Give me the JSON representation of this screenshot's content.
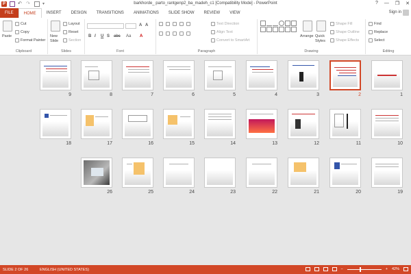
{
  "window": {
    "title": "barkhorde_ parto_rantgenp2_ba_madeh_c1 [Compatibility Mode] - PowerPoint",
    "app_icon": "P",
    "controls": [
      "?",
      "—",
      "❐",
      "✕"
    ]
  },
  "tabs": {
    "file": "FILE",
    "items": [
      "HOME",
      "INSERT",
      "DESIGN",
      "TRANSITIONS",
      "ANIMATIONS",
      "SLIDE SHOW",
      "REVIEW",
      "VIEW"
    ],
    "active": "HOME",
    "sign_in": "Sign in"
  },
  "ribbon": {
    "clipboard": {
      "label": "Clipboard",
      "paste": "Paste",
      "cut": "Cut",
      "copy": "Copy",
      "format_painter": "Format Painter"
    },
    "slides": {
      "label": "Slides",
      "new_slide": "New Slide",
      "layout": "Layout",
      "reset": "Reset",
      "section": "Section"
    },
    "font": {
      "label": "Font",
      "font_name": "",
      "font_size": "",
      "bold": "B",
      "italic": "I",
      "underline": "U",
      "strike": "S",
      "spacing": "abc",
      "aa": "Aa",
      "font_color": "A"
    },
    "paragraph": {
      "label": "Paragraph",
      "text_direction": "Text Direction",
      "align_text": "Align Text",
      "convert_smartart": "Convert to SmartArt"
    },
    "drawing": {
      "label": "Drawing",
      "arrange": "Arrange",
      "quick_styles": "Quick Styles",
      "shape_fill": "Shape Fill",
      "shape_outline": "Shape Outline",
      "shape_effects": "Shape Effects"
    },
    "editing": {
      "label": "Editing",
      "find": "Find",
      "replace": "Replace",
      "select": "Select"
    }
  },
  "slides": {
    "selected": "2",
    "rows": [
      [
        "1",
        "2",
        "3",
        "4",
        "5",
        "6",
        "7",
        "8",
        "9"
      ],
      [
        "10",
        "11",
        "12",
        "13",
        "14",
        "15",
        "16",
        "17",
        "18"
      ],
      [
        "19",
        "20",
        "21",
        "22",
        "23",
        "24",
        "25",
        "26"
      ]
    ]
  },
  "status": {
    "slide": "SLIDE 2 OF 26",
    "language": "ENGLISH (UNITED STATES)",
    "zoom": "42%",
    "zoom_minus": "−",
    "zoom_plus": "+"
  },
  "colors": {
    "accent": "#d24726",
    "file_tab": "#c43e1c"
  }
}
